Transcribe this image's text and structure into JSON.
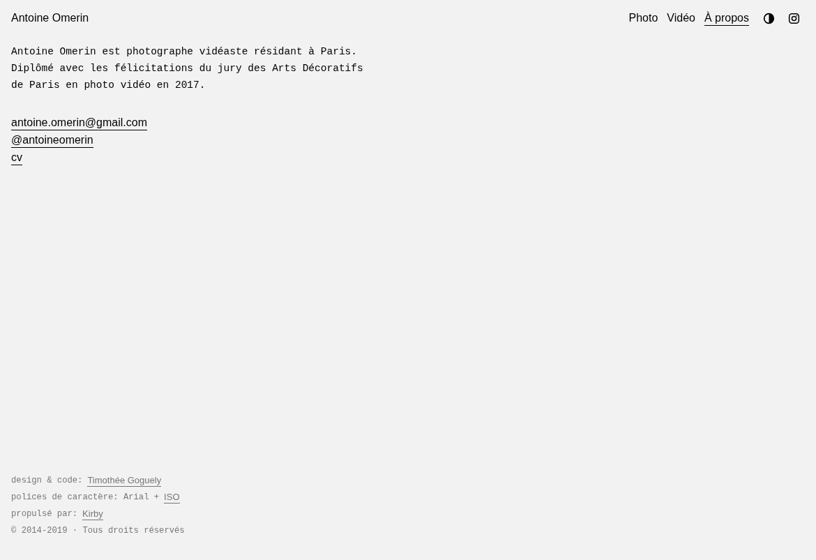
{
  "header": {
    "site_title": "Antoine Omerin",
    "nav": [
      {
        "label": "Photo",
        "selected": false
      },
      {
        "label": "Vidéo",
        "selected": false
      },
      {
        "label": "À propos",
        "selected": true
      }
    ]
  },
  "bio": [
    "Antoine Omerin est photographe vidéaste résidant à Paris.",
    "Diplômé avec les félicitations du jury des Arts Décoratifs",
    "de Paris en photo vidéo en 2017."
  ],
  "contact_links": [
    "antoine.omerin@gmail.com",
    "@antoineomerin",
    "cv"
  ],
  "footer": [
    {
      "text": "design & code:",
      "link": "Timothée Goguely"
    },
    {
      "text": "polices de caractère: Arial +",
      "link": "ISO"
    },
    {
      "text": "propulsé par:",
      "link": "Kirby"
    },
    {
      "text": "© 2014-2019 · Tous droits réservés"
    }
  ]
}
